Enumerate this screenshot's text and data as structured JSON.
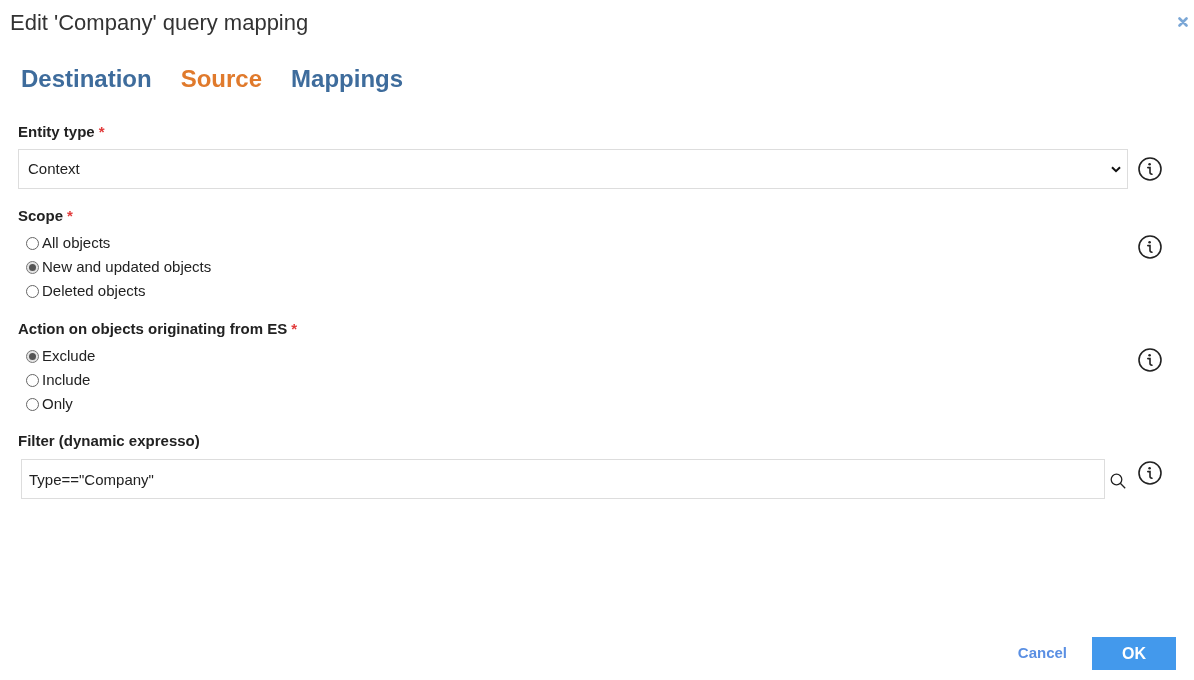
{
  "dialog": {
    "title": "Edit 'Company' query mapping"
  },
  "tabs": [
    {
      "label": "Destination",
      "selected": false
    },
    {
      "label": "Source",
      "selected": true
    },
    {
      "label": "Mappings",
      "selected": false
    }
  ],
  "fields": [
    {
      "kind": "select",
      "label": "Entity type",
      "required_mark": "*",
      "value": "Context"
    },
    {
      "kind": "radio",
      "label": "Scope",
      "required_mark": "*",
      "options": [
        {
          "label": "All objects",
          "selected": false
        },
        {
          "label": "New and updated objects",
          "selected": true
        },
        {
          "label": "Deleted objects",
          "selected": false
        }
      ]
    },
    {
      "kind": "radio",
      "label": "Action on objects originating from ES",
      "required_mark": "*",
      "options": [
        {
          "label": "Exclude",
          "selected": true
        },
        {
          "label": "Include",
          "selected": false
        },
        {
          "label": "Only",
          "selected": false
        }
      ]
    },
    {
      "kind": "text",
      "label": "Filter (dynamic expresso)",
      "value": "Type==\"Company\""
    }
  ],
  "buttons": [
    {
      "kind": "link",
      "label": "Cancel"
    },
    {
      "kind": "primary",
      "label": "OK"
    }
  ]
}
